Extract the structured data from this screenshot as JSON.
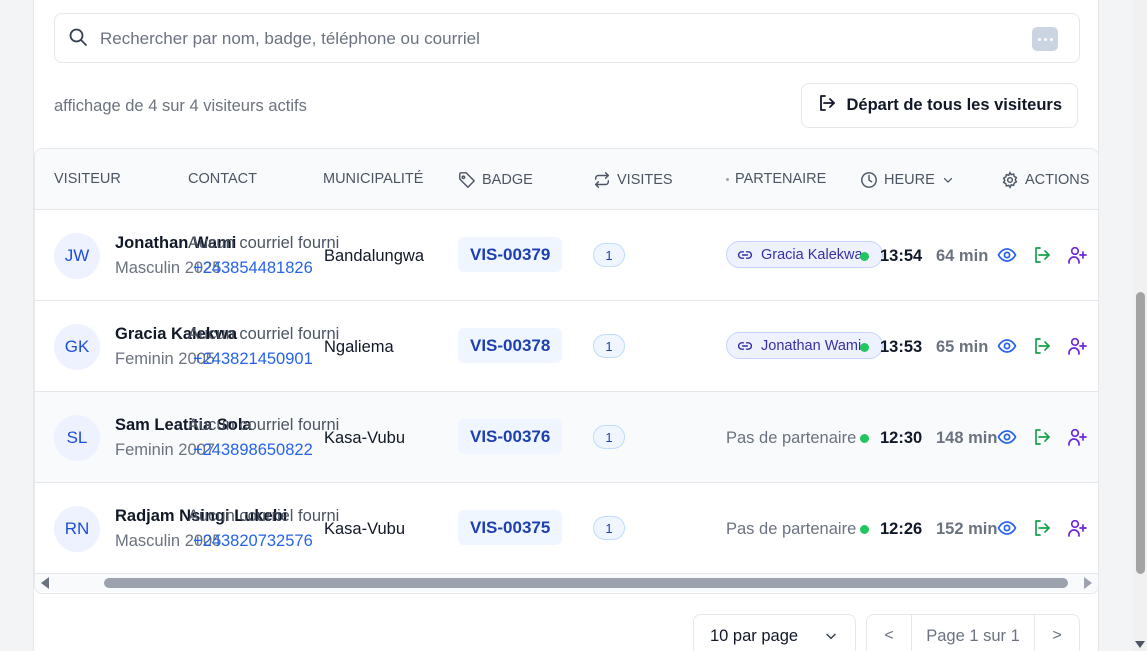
{
  "search": {
    "placeholder": "Rechercher par nom, badge, téléphone ou courriel"
  },
  "summary_text": "affichage de 4 sur 4 visiteurs actifs",
  "depart_all_label": "Départ de tous les visiteurs",
  "columns": {
    "visitor": "VISITEUR",
    "contact": "CONTACT",
    "municipality": "MUNICIPALITÉ",
    "badge": "BADGE",
    "visits": "VISITES",
    "partner": "PARTENAIRE",
    "time": "HEURE",
    "actions": "ACTIONS"
  },
  "rows": [
    {
      "initials": "JW",
      "name": "Jonathan Wami",
      "gender": "Masculin",
      "year": "2025",
      "email": "Aucun courriel fourni",
      "phone": "+243854481826",
      "municipality": "Bandalungwa",
      "badge": "VIS-00379",
      "visits": "1",
      "partner": "Gracia Kalekwa",
      "time": "13:54",
      "duration": "64 min"
    },
    {
      "initials": "GK",
      "name": "Gracia Kalekwa",
      "gender": "Feminin",
      "year": "2005",
      "email": "Aucun courriel fourni",
      "phone": "+243821450901",
      "municipality": "Ngaliema",
      "badge": "VIS-00378",
      "visits": "1",
      "partner": "Jonathan Wami",
      "time": "13:53",
      "duration": "65 min"
    },
    {
      "initials": "SL",
      "name": "Sam Leatitia Sola",
      "gender": "Feminin",
      "year": "2007",
      "email": "Aucun courriel fourni",
      "phone": "+243898650822",
      "municipality": "Kasa-Vubu",
      "badge": "VIS-00376",
      "visits": "1",
      "partner": "Pas de partenaire",
      "time": "12:30",
      "duration": "148 min"
    },
    {
      "initials": "RN",
      "name": "Radjam Nsingi Lukebi",
      "gender": "Masculin",
      "year": "2005",
      "email": "Aucun courriel fourni",
      "phone": "+243820732576",
      "municipality": "Kasa-Vubu",
      "badge": "VIS-00375",
      "visits": "1",
      "partner": "Pas de partenaire",
      "time": "12:26",
      "duration": "152 min"
    }
  ],
  "pagination": {
    "per_page_label": "10 par page",
    "prev": "<",
    "page_info": "Page 1 sur 1",
    "next": ">"
  },
  "colors": {
    "accent": "#1d4ed8",
    "success": "#22c55e",
    "partner_chip": "#eef2ff",
    "add_icon": "#6d28d9"
  }
}
